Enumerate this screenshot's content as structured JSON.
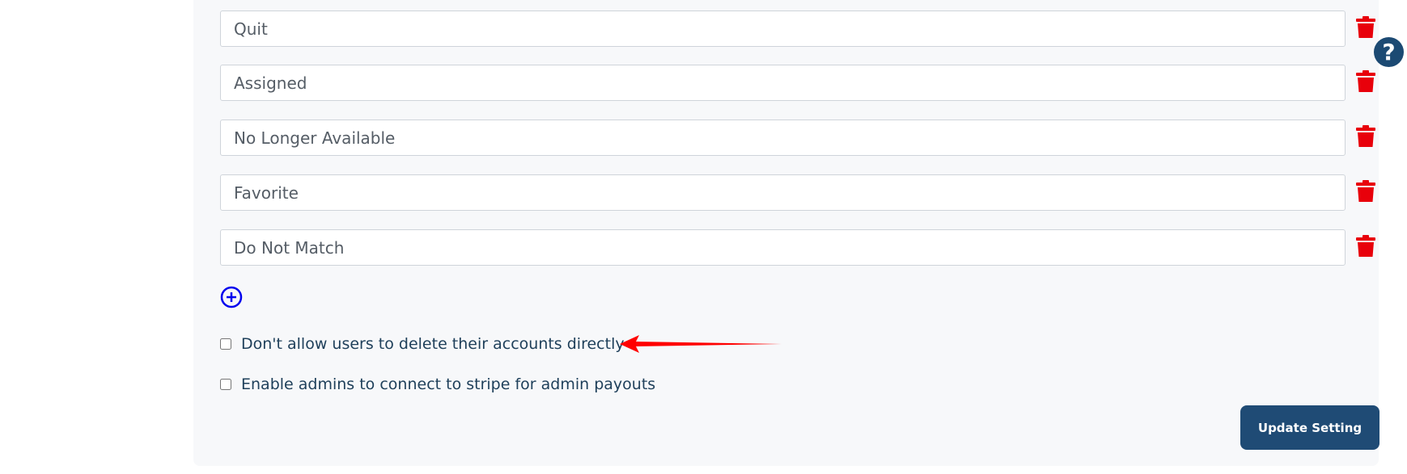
{
  "status_options": [
    {
      "value": "Quit"
    },
    {
      "value": "Assigned"
    },
    {
      "value": "No Longer Available"
    },
    {
      "value": "Favorite"
    },
    {
      "value": "Do Not Match"
    }
  ],
  "help": {
    "label": "?"
  },
  "settings": {
    "disallow_delete_label": "Don't allow users to delete their accounts directly",
    "enable_stripe_label": "Enable admins to connect to stripe for admin payouts"
  },
  "actions": {
    "update_label": "Update Setting"
  },
  "icons": {
    "delete": "trash-icon",
    "add": "plus-circle-icon",
    "help": "question-circle-icon",
    "annotation": "arrow-icon"
  },
  "colors": {
    "delete_icon": "#e8000b",
    "add_icon": "#0000ee",
    "primary": "#1f4b75",
    "annotation_arrow": "#ff0000"
  }
}
